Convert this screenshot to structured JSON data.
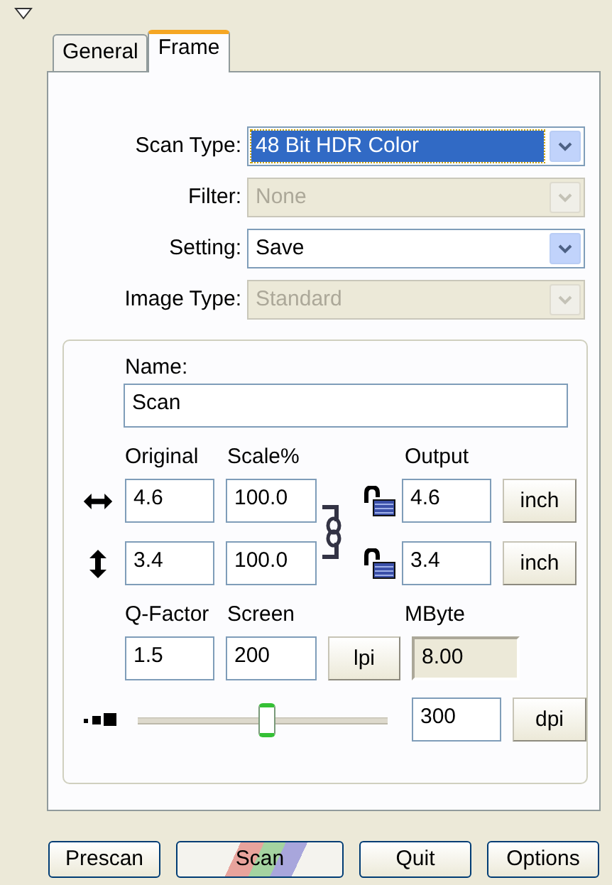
{
  "tabs": [
    {
      "label": "General",
      "selected": false
    },
    {
      "label": "Frame",
      "selected": true
    }
  ],
  "settings": [
    {
      "label": "Scan Type:",
      "value": "48 Bit HDR Color",
      "disabled": false,
      "focused": true
    },
    {
      "label": "Filter:",
      "value": "None",
      "disabled": true,
      "focused": false
    },
    {
      "label": "Setting:",
      "value": "Save",
      "disabled": false,
      "focused": false
    },
    {
      "label": "Image Type:",
      "value": "Standard",
      "disabled": true,
      "focused": false
    }
  ],
  "name": {
    "label": "Name:",
    "value": "Scan"
  },
  "size": {
    "headers": [
      "Original",
      "Scale%",
      "Output"
    ],
    "rows": [
      {
        "kind": "width",
        "original": "4.6",
        "scale": "100.0",
        "output": "4.6",
        "unit": "inch"
      },
      {
        "kind": "height",
        "original": "3.4",
        "scale": "100.0",
        "output": "3.4",
        "unit": "inch"
      }
    ]
  },
  "quality": {
    "headers": [
      "Q-Factor",
      "Screen",
      "MByte"
    ],
    "q_factor": "1.5",
    "screen": "200",
    "screen_unit": "lpi",
    "mbyte": "8.00"
  },
  "resolution": {
    "level": 0.52,
    "value": "300",
    "unit": "dpi"
  },
  "buttons": [
    {
      "label": "Prescan",
      "kind": "plain"
    },
    {
      "label": "Scan",
      "kind": "rainbow"
    },
    {
      "label": "Quit",
      "kind": "plain"
    },
    {
      "label": "Options",
      "kind": "plain"
    }
  ]
}
